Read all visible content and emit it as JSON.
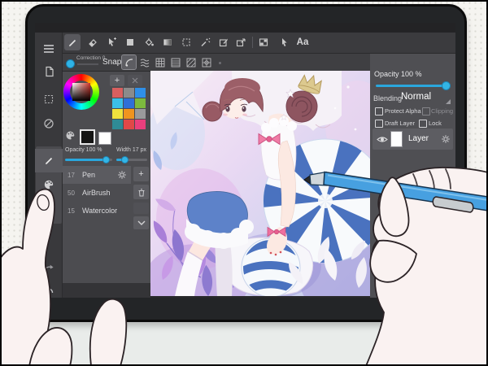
{
  "toolbar": {
    "text_tool_label": "Aa",
    "correction_label": "Correction 0",
    "snap_label": "Snap"
  },
  "color_panel": {
    "plus_label": "+",
    "swatches": [
      "#d95f5f",
      "#8b8b8b",
      "#2f8fe8",
      "#3bc0e8",
      "#2f6fd8",
      "#7cb93e",
      "#efe23d",
      "#f0941f",
      "#9a9a9c",
      "#2f8b96",
      "#e04848",
      "#ea3f7d"
    ],
    "foreground_color": "#141414",
    "background_color": "#ffffff"
  },
  "brush_panel": {
    "opacity_label": "Opacity 100 %",
    "width_label": "Width 17 px",
    "plus_label": "+",
    "brushes": [
      {
        "size": "17",
        "name": "Pen"
      },
      {
        "size": "50",
        "name": "AirBrush"
      },
      {
        "size": "15",
        "name": "Watercolor"
      }
    ]
  },
  "layer_panel": {
    "opacity_label": "Opacity 100 %",
    "blending_label": "Blending",
    "blending_value": "Normal",
    "protect_alpha_label": "Protect Alpha",
    "clipping_label": "Clipping",
    "draft_label": "Draft Layer",
    "lock_label": "Lock",
    "layer_name": "Layer",
    "plus_label": "+"
  },
  "colors": {
    "accent_blue": "#33b5e5",
    "stylus_blue": "#47a0e0",
    "stripe_blue": "#4a72bf"
  }
}
